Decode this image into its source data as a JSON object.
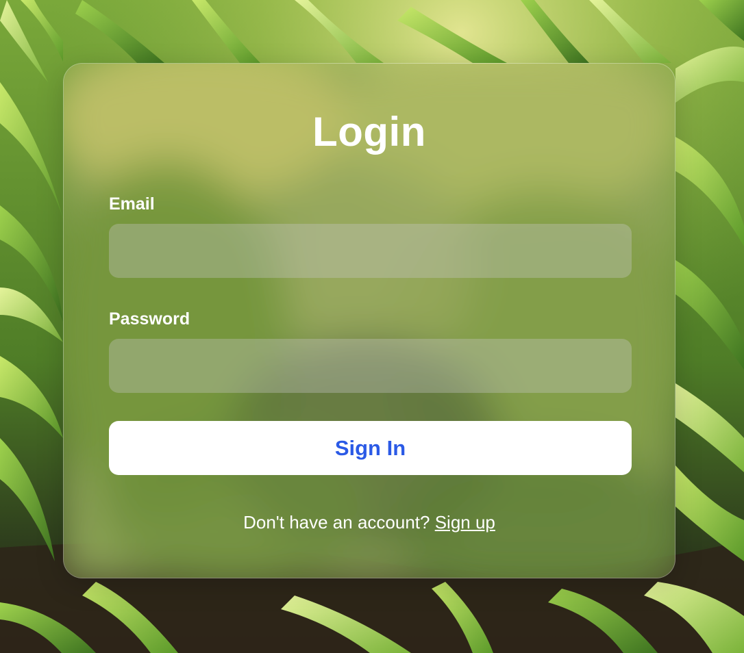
{
  "login": {
    "title": "Login",
    "email_label": "Email",
    "email_value": "",
    "email_placeholder": "",
    "password_label": "Password",
    "password_value": "",
    "password_placeholder": "",
    "submit_label": "Sign In",
    "signup_prompt": "Don't have an account? ",
    "signup_link": "Sign up"
  },
  "colors": {
    "button_text": "#2b5ae6",
    "button_bg": "#ffffff",
    "text": "#ffffff"
  }
}
